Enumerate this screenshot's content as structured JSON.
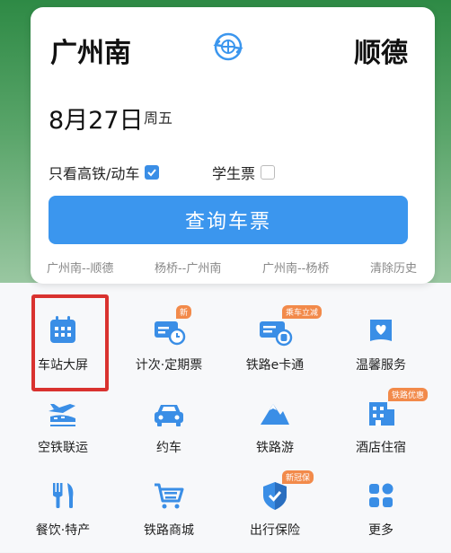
{
  "search": {
    "from_station": "广州南",
    "to_station": "顺德",
    "date": "8月27日",
    "weekday": "周五",
    "option_gaotie": "只看高铁/动车",
    "option_student": "学生票",
    "query_button": "查询车票",
    "history": [
      "广州南--顺德",
      "杨桥--广州南",
      "广州南--杨桥"
    ],
    "clear_history": "清除历史"
  },
  "services": [
    {
      "label": "车站大屏",
      "icon": "calendar-icon",
      "badge": ""
    },
    {
      "label": "计次·定期票",
      "icon": "ticket-clock-icon",
      "badge": "新"
    },
    {
      "label": "铁路e卡通",
      "icon": "ecard-icon",
      "badge": "乘车立减"
    },
    {
      "label": "温馨服务",
      "icon": "heart-bag-icon",
      "badge": ""
    },
    {
      "label": "空铁联运",
      "icon": "plane-train-icon",
      "badge": ""
    },
    {
      "label": "约车",
      "icon": "car-icon",
      "badge": ""
    },
    {
      "label": "铁路游",
      "icon": "mountain-icon",
      "badge": ""
    },
    {
      "label": "酒店住宿",
      "icon": "hotel-icon",
      "badge": "铁路优惠"
    },
    {
      "label": "餐饮·特产",
      "icon": "fork-knife-icon",
      "badge": ""
    },
    {
      "label": "铁路商城",
      "icon": "cart-icon",
      "badge": ""
    },
    {
      "label": "出行保险",
      "icon": "shield-icon",
      "badge": "新冠保"
    },
    {
      "label": "更多",
      "icon": "more-grid-icon",
      "badge": ""
    }
  ],
  "colors": {
    "primary": "#3b96ee",
    "highlight_box": "#d9322f",
    "badge": "#f28a4a"
  }
}
